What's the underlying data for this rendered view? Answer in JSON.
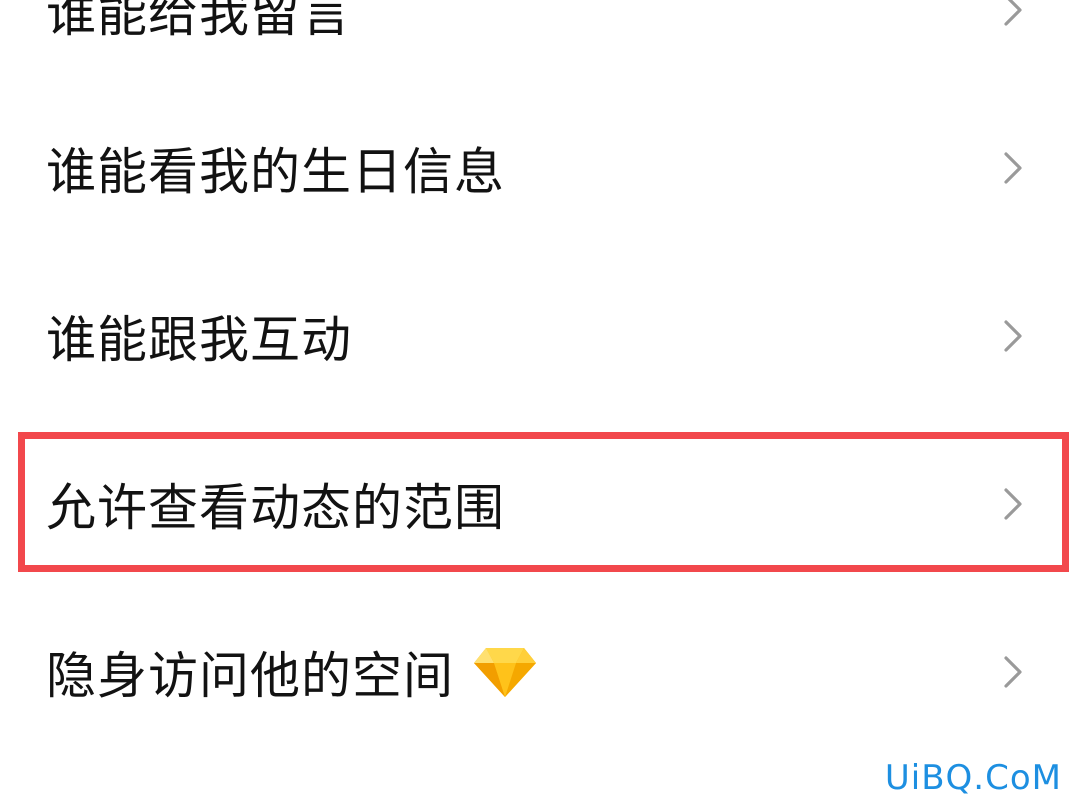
{
  "privacy_menu": {
    "items": [
      {
        "label": "谁能给我留言",
        "icon": "chevron-right-icon"
      },
      {
        "label": "谁能看我的生日信息",
        "icon": "chevron-right-icon"
      },
      {
        "label": "谁能跟我互动",
        "icon": "chevron-right-icon"
      },
      {
        "label": "允许查看动态的范围",
        "icon": "chevron-right-icon",
        "highlighted": true
      },
      {
        "label": "隐身访问他的空间",
        "icon": "chevron-right-icon",
        "badge_icon": "diamond-icon"
      }
    ]
  },
  "annotation": {
    "highlight_color": "#f2484c"
  },
  "watermark": {
    "text": "UiBQ.CoM",
    "color": "#1d8fe1"
  }
}
